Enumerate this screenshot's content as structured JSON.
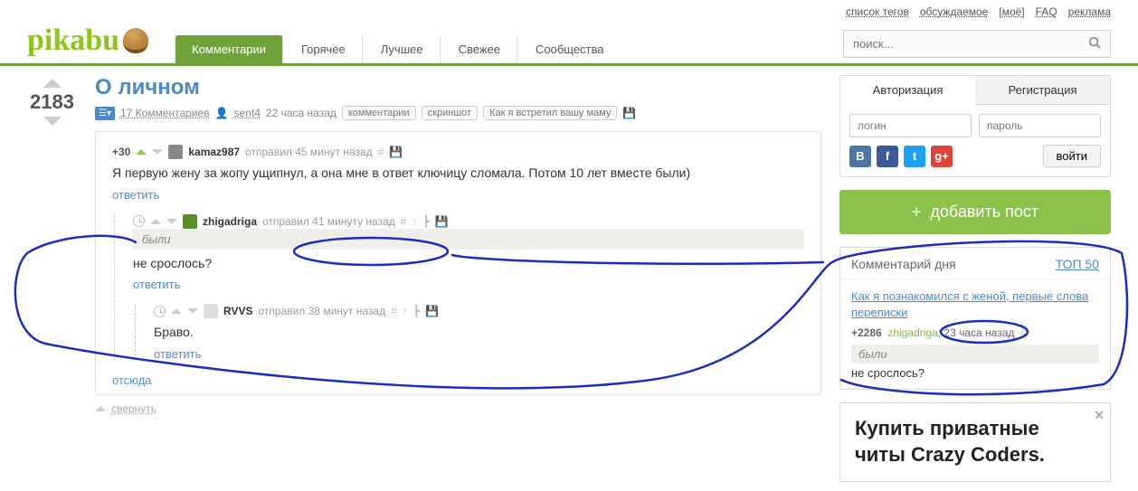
{
  "topLinks": [
    "список тегов",
    "обсуждаемое",
    "[моё]",
    "FAQ",
    "реклама"
  ],
  "logo": "pikabu",
  "nav": {
    "items": [
      "Комментарии",
      "Горячее",
      "Лучшее",
      "Свежее",
      "Сообщества"
    ],
    "active": 0
  },
  "search": {
    "placeholder": "поиск..."
  },
  "post": {
    "score": "2183",
    "title": "О личном",
    "commentsLink": "17 Комментариев",
    "author": "sent4",
    "time": "22 часа назад",
    "tags": [
      "комментарии",
      "скриншот",
      "Как я встретил вашу маму"
    ]
  },
  "comments": [
    {
      "rating": "+30",
      "user": "kamaz987",
      "meta": "отправил 45 минут назад",
      "body": "Я первую жену за жопу ущипнул, а она мне в ответ ключицу сломала. Потом 10 лет вместе были)",
      "reply": "ответить"
    },
    {
      "user": "zhigadriga",
      "meta": "отправил 41 минуту назад",
      "quote": "были",
      "body": "не срослось?",
      "reply": "ответить"
    },
    {
      "user": "RVVS",
      "meta": "отправил 38 минут назад",
      "body": "Браво.",
      "reply": "ответить"
    }
  ],
  "fromHere": "отсюда",
  "collapse": "свернуть",
  "auth": {
    "tabs": [
      "Авторизация",
      "Регистрация"
    ],
    "loginPh": "логин",
    "passPh": "пароль",
    "loginBtn": "войти"
  },
  "addPost": "добавить пост",
  "cod": {
    "title": "Комментарий дня",
    "topLink": "ТОП 50",
    "postTitle": "Как я познакомился с женой, первые слова переписки",
    "rating": "+2286",
    "user": "zhigadriga",
    "time": "23 часа назад",
    "quote": "были",
    "body": "не срослось?"
  },
  "ad": {
    "text1": "Купить приватные",
    "text2": "читы Crazy Coders."
  }
}
